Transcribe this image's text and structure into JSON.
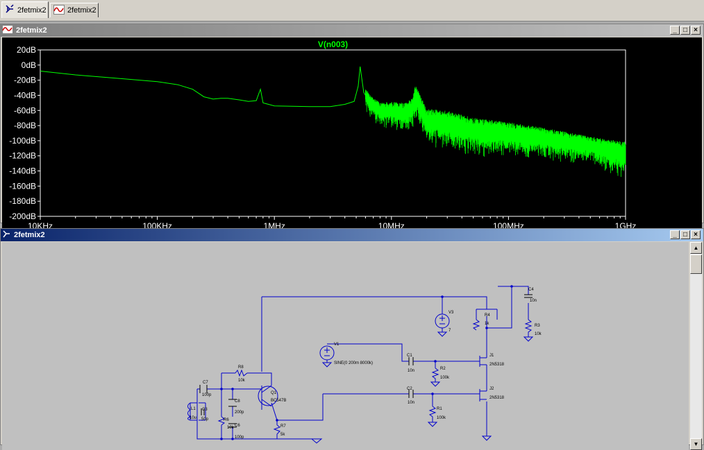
{
  "tabs": [
    {
      "label": "2fetmix2",
      "icon": "schematic-icon",
      "active": true
    },
    {
      "label": "2fetmix2",
      "icon": "waveform-icon",
      "active": false
    }
  ],
  "plot_window": {
    "title": "2fetmix2",
    "trace_label": "V(n003)"
  },
  "schematic_window": {
    "title": "2fetmix2",
    "labels": {
      "c4": "C4",
      "c4v": "10n",
      "v3": "V3",
      "v3v": "7",
      "r4": "R4",
      "r4v": "1k",
      "r3": "R3",
      "r3v": "10k",
      "v1": "V1",
      "v1v": "SINE(0 200m 8000k)",
      "c1": "C1",
      "c1v": "10n",
      "r2": "R2",
      "r2v": "100k",
      "j1": "J1",
      "j1v": "2N5318",
      "r8": "R8",
      "r8v": "10k",
      "c7": "C7",
      "c7v": "100p",
      "q1": "Q1",
      "q1v": "BC547B",
      "c8": "C8",
      "c8v": "200p",
      "c2": "C2",
      "c2v": "10n",
      "j2": "J2",
      "j2v": "2N5318",
      "l1": "L1",
      "l1v": "10u",
      "c3": "C3",
      "c3v": "50p",
      "r6": "R6",
      "r6v": "10k",
      "c6": "C6",
      "c6v": "100p",
      "r7": "R7",
      "r7v": "5k",
      "r1": "R1",
      "r1v": "100k"
    }
  },
  "colors": {
    "trace": "#00ff00",
    "wire": "#0000cc",
    "plot_bg": "#000000",
    "schem_bg": "#c0c0c0",
    "axis_text": "#ffffff"
  },
  "chart_data": {
    "type": "line",
    "title": "V(n003)",
    "xlabel": "",
    "ylabel": "",
    "x_scale": "log",
    "xlim": [
      10000,
      1000000000
    ],
    "ylim": [
      -200,
      20
    ],
    "x_tick_labels": [
      "10KHz",
      "100KHz",
      "1MHz",
      "10MHz",
      "100MHz",
      "1GHz"
    ],
    "y_tick_labels": [
      "20dB",
      "0dB",
      "-20dB",
      "-40dB",
      "-60dB",
      "-80dB",
      "-100dB",
      "-120dB",
      "-140dB",
      "-160dB",
      "-180dB",
      "-200dB"
    ],
    "grid": false,
    "series": [
      {
        "name": "V(n003)",
        "x": [
          10000,
          20000,
          50000,
          100000,
          150000,
          200000,
          250000,
          300000,
          350000,
          400000,
          500000,
          600000,
          700000,
          760000,
          800000,
          1000000,
          2000000,
          3000000,
          4000000,
          4800000,
          5200000,
          5400000,
          5800000,
          6500000,
          8000000,
          10000000,
          13000000,
          15000000,
          16000000,
          20000000,
          30000000,
          50000000,
          100000000,
          200000000,
          500000000,
          1000000000
        ],
        "y": [
          -8,
          -13,
          -18,
          -22,
          -26,
          -32,
          -42,
          -45,
          -44,
          -44,
          -46,
          -48,
          -47,
          -32,
          -50,
          -54,
          -55,
          -55,
          -52,
          -48,
          -28,
          -2,
          -36,
          -50,
          -62,
          -62,
          -65,
          -60,
          -42,
          -75,
          -80,
          -88,
          -92,
          -98,
          -108,
          -120
        ]
      }
    ],
    "noise_from_x": 6000000,
    "noise_band_db": [
      [
        6000000,
        14
      ],
      [
        30000000,
        26
      ],
      [
        100000000,
        22
      ],
      [
        500000000,
        18
      ],
      [
        1000000000,
        25
      ]
    ]
  }
}
